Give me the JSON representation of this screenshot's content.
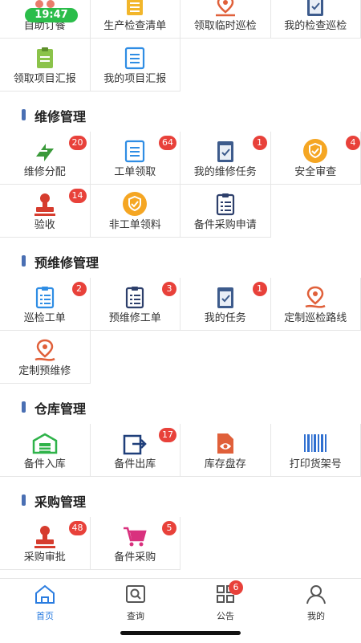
{
  "status": {
    "time": "19:47"
  },
  "top_row": [
    {
      "label": "自助订餐",
      "icon": "meal-icon"
    },
    {
      "label": "生产检查清单",
      "icon": "checklist-icon"
    },
    {
      "label": "领取临时巡检",
      "icon": "route-pin-icon"
    },
    {
      "label": "我的检查巡检",
      "icon": "clipboard-check-icon"
    }
  ],
  "project_row": [
    {
      "label": "领取项目汇报",
      "icon": "clipboard-green-icon"
    },
    {
      "label": "我的项目汇报",
      "icon": "list-doc-icon"
    }
  ],
  "sections": {
    "maintenance": {
      "title": "维修管理",
      "items": [
        {
          "label": "维修分配",
          "badge": "20",
          "icon": "swap-arrows-icon"
        },
        {
          "label": "工单领取",
          "badge": "64",
          "icon": "list-doc-icon"
        },
        {
          "label": "我的维修任务",
          "badge": "1",
          "icon": "clipboard-check-icon"
        },
        {
          "label": "安全审查",
          "badge": "4",
          "icon": "shield-icon"
        },
        {
          "label": "验收",
          "badge": "14",
          "icon": "stamp-icon"
        },
        {
          "label": "非工单领料",
          "badge": "",
          "icon": "shield-icon"
        },
        {
          "label": "备件采购申请",
          "badge": "",
          "icon": "clipboard-list-icon"
        }
      ]
    },
    "preventive": {
      "title": "预维修管理",
      "items": [
        {
          "label": "巡检工单",
          "badge": "2",
          "icon": "clipboard-list-icon"
        },
        {
          "label": "预维修工单",
          "badge": "3",
          "icon": "clipboard-list-icon"
        },
        {
          "label": "我的任务",
          "badge": "1",
          "icon": "clipboard-check-icon"
        },
        {
          "label": "定制巡检路线",
          "badge": "",
          "icon": "route-pin-icon"
        },
        {
          "label": "定制预维修",
          "badge": "",
          "icon": "route-pin-icon"
        }
      ]
    },
    "warehouse": {
      "title": "仓库管理",
      "items": [
        {
          "label": "备件入库",
          "badge": "",
          "icon": "warehouse-icon"
        },
        {
          "label": "备件出库",
          "badge": "17",
          "icon": "export-icon"
        },
        {
          "label": "库存盘存",
          "badge": "",
          "icon": "doc-eye-icon"
        },
        {
          "label": "打印货架号",
          "badge": "",
          "icon": "barcode-icon"
        }
      ]
    },
    "purchase": {
      "title": "采购管理",
      "items": [
        {
          "label": "采购审批",
          "badge": "48",
          "icon": "stamp-icon"
        },
        {
          "label": "备件采购",
          "badge": "5",
          "icon": "cart-icon"
        }
      ]
    }
  },
  "tabbar": {
    "items": [
      {
        "label": "首页",
        "icon": "home-icon",
        "active": true
      },
      {
        "label": "查询",
        "icon": "search-icon",
        "active": false
      },
      {
        "label": "公告",
        "icon": "grid-icon",
        "badge": "6",
        "active": false
      },
      {
        "label": "我的",
        "icon": "user-icon",
        "active": false
      }
    ]
  },
  "colors": {
    "accent": "#2a7ce0",
    "badge": "#e8413a",
    "section_bar": "#4a6fb3"
  }
}
